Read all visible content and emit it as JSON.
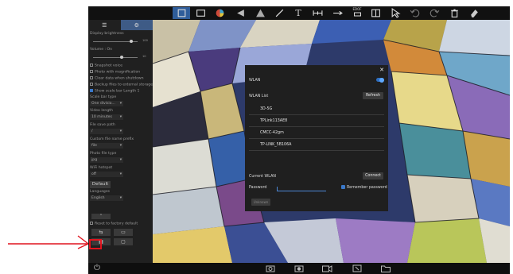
{
  "sidebar": {
    "display_brightness": "Display brightness",
    "brightness_value": "100",
    "volume_label": "Volume : On",
    "volume_value": "10",
    "snapshot_voice": "Snapshot voice",
    "photo_magnification": "Photo with magnification",
    "clear_data": "Clear data when shutdown",
    "backup_files": "Backup files to external storage",
    "show_scale": "Show scale bar  Length",
    "scale_len": "1",
    "scale_bar_type": "Scale bar type",
    "scale_bar_value": "One divisio...",
    "video_length": "Video length",
    "video_value": "10 minutes",
    "file_save_path": "File save path",
    "file_save_value": "/",
    "custom_prefix": "Custom file name prefix",
    "custom_prefix_value": "file",
    "photo_file_type": "Photo file type",
    "photo_file_value": "jpg",
    "wifi_hotspot": "WiFi hotspot",
    "wifi_hotspot_value": "off",
    "default_btn": "Default",
    "languages": "Languages",
    "languages_value": "English",
    "reset_factory": "Reset to factory default"
  },
  "toolbar": {
    "sdof_label": "EDOF"
  },
  "wlan_dialog": {
    "wlan_label": "WLAN",
    "wlan_list_label": "WLAN List",
    "refresh_btn": "Refresh",
    "networks": [
      "3D-5G",
      "TPLink113AE8",
      "CMCC-42gm",
      "TP-LINK_5B106A"
    ],
    "current_wlan_label": "Current WLAN",
    "connect_btn": "Connect",
    "password_label": "Password",
    "remember_label": "Remember password",
    "unknown_btn": "Unknown"
  },
  "colors": {
    "accent": "#2f5d9a",
    "callout": "#e0141e"
  }
}
